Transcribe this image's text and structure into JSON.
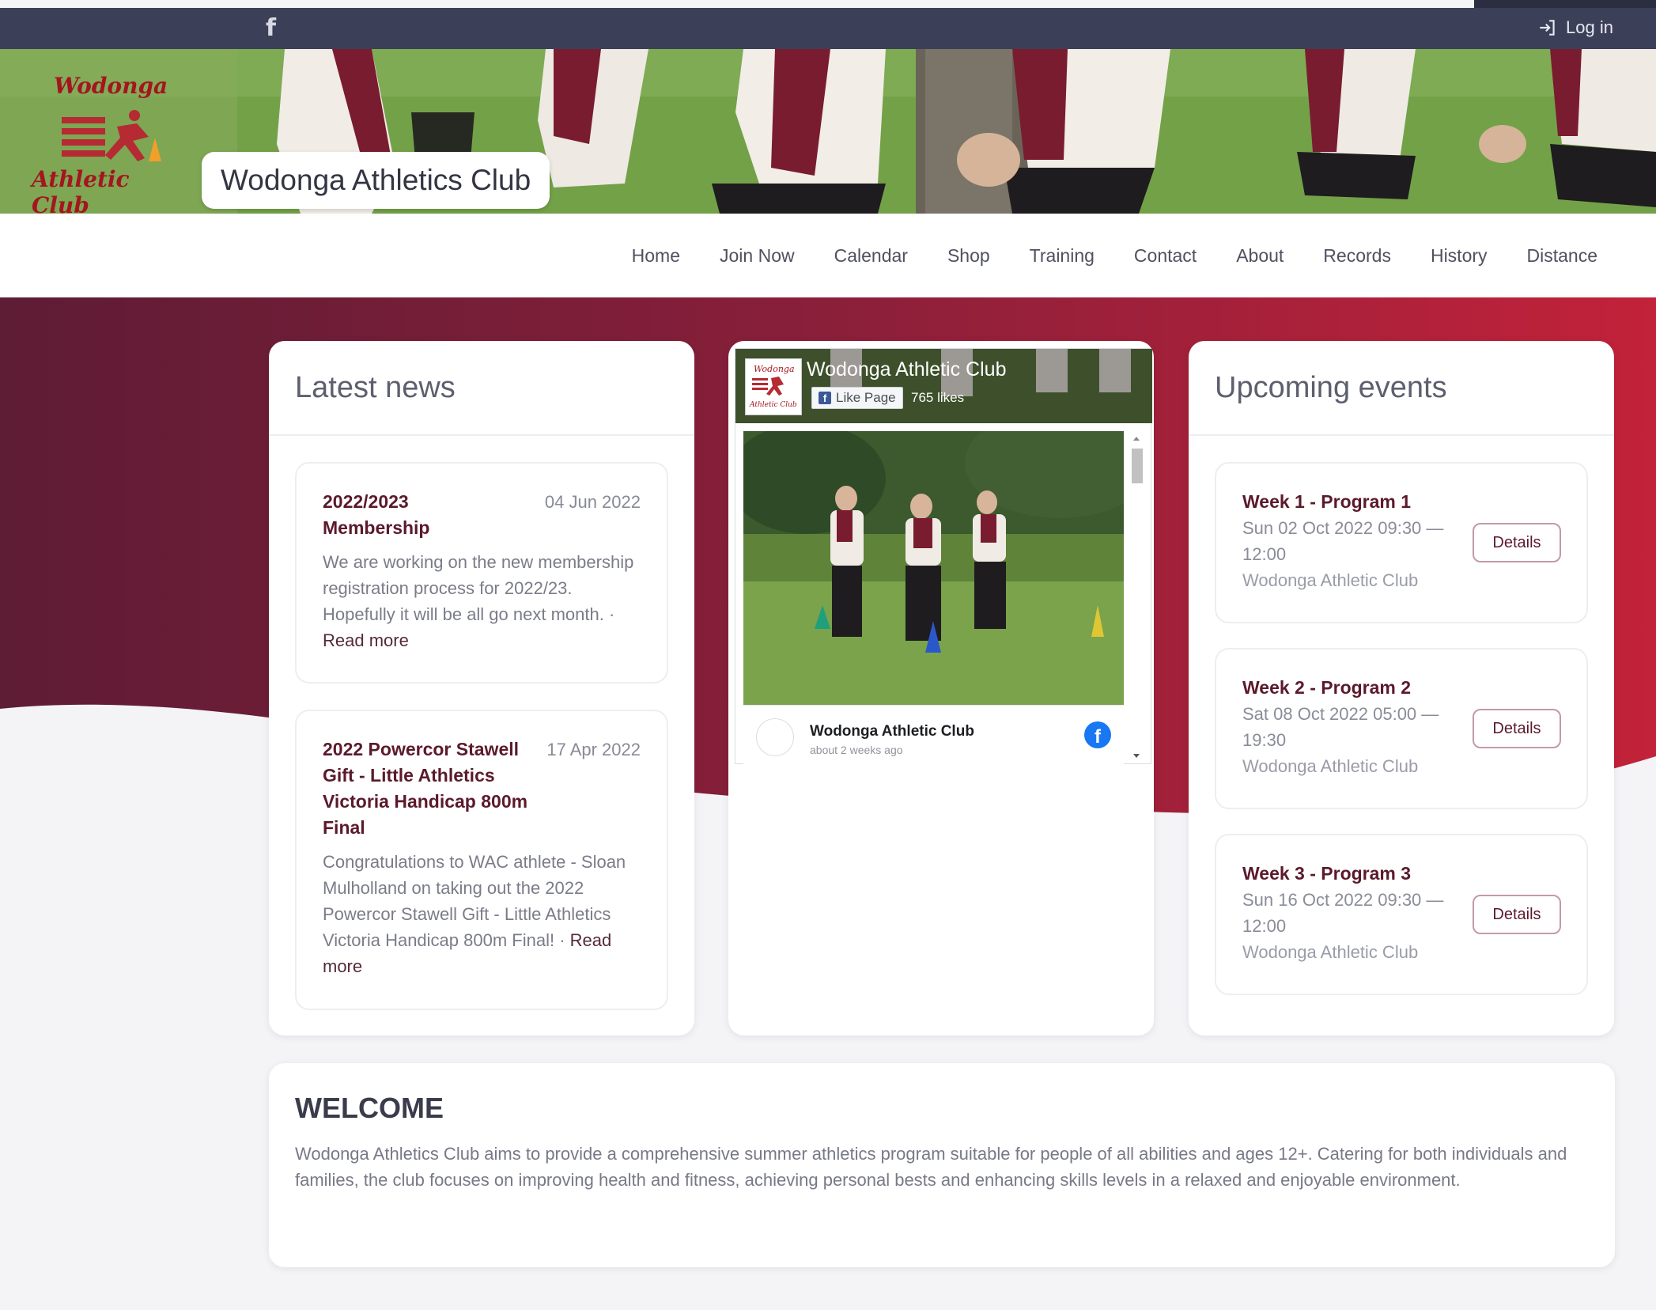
{
  "topbar": {
    "facebook_glyph": "f",
    "login_label": "Log in"
  },
  "banner": {
    "logo_top": "Wodonga",
    "logo_bottom": "Athletic Club",
    "site_title": "Wodonga Athletics Club"
  },
  "nav": {
    "items": [
      "Home",
      "Join Now",
      "Calendar",
      "Shop",
      "Training",
      "Contact",
      "About",
      "Records",
      "History",
      "Distance"
    ]
  },
  "news": {
    "title": "Latest news",
    "items": [
      {
        "title": "2022/2023 Membership",
        "date": "04 Jun 2022",
        "body": "We are working on the new membership registration process for 2022/23. Hopefully it will be all go next month. · ",
        "read_more": "Read more"
      },
      {
        "title": "2022 Powercor Stawell Gift - Little Athletics Victoria Handicap 800m Final",
        "date": "17 Apr 2022",
        "body": "Congratulations to WAC athlete - Sloan Mulholland on taking out the 2022 Powercor Stawell Gift - Little Athletics Victoria Handicap 800m Final! · ",
        "read_more": "Read more"
      }
    ]
  },
  "facebook": {
    "page_name": "Wodonga Athletic Club",
    "like_button": "Like Page",
    "likes": "765 likes",
    "post_author": "Wodonga Athletic Club",
    "post_time": "about 2 weeks ago",
    "avatar_top": "Wodonga",
    "avatar_bottom": "Athletic Club"
  },
  "events": {
    "title": "Upcoming events",
    "items": [
      {
        "title": "Week 1 - Program 1",
        "time": "Sun 02 Oct 2022 09:30 — 12:00",
        "location": "Wodonga Athletic Club",
        "button": "Details"
      },
      {
        "title": "Week 2 - Program 2",
        "time": "Sat 08 Oct 2022 05:00 — 19:30",
        "location": "Wodonga Athletic Club",
        "button": "Details"
      },
      {
        "title": "Week 3 - Program 3",
        "time": "Sun 16 Oct 2022 09:30 — 12:00",
        "location": "Wodonga Athletic Club",
        "button": "Details"
      }
    ]
  },
  "welcome": {
    "title": "WELCOME",
    "body": "Wodonga Athletics Club aims to provide a comprehensive summer athletics program suitable for people of all abilities and ages 12+. Catering for both individuals and families, the club focuses on improving health and fitness, achieving personal bests and enhancing skills levels in a relaxed and enjoyable environment."
  },
  "colors": {
    "topbar": "#3c3f58",
    "maroon_dark": "#5e1c35",
    "red": "#c2223a",
    "accent_text": "#5b1a2c"
  }
}
